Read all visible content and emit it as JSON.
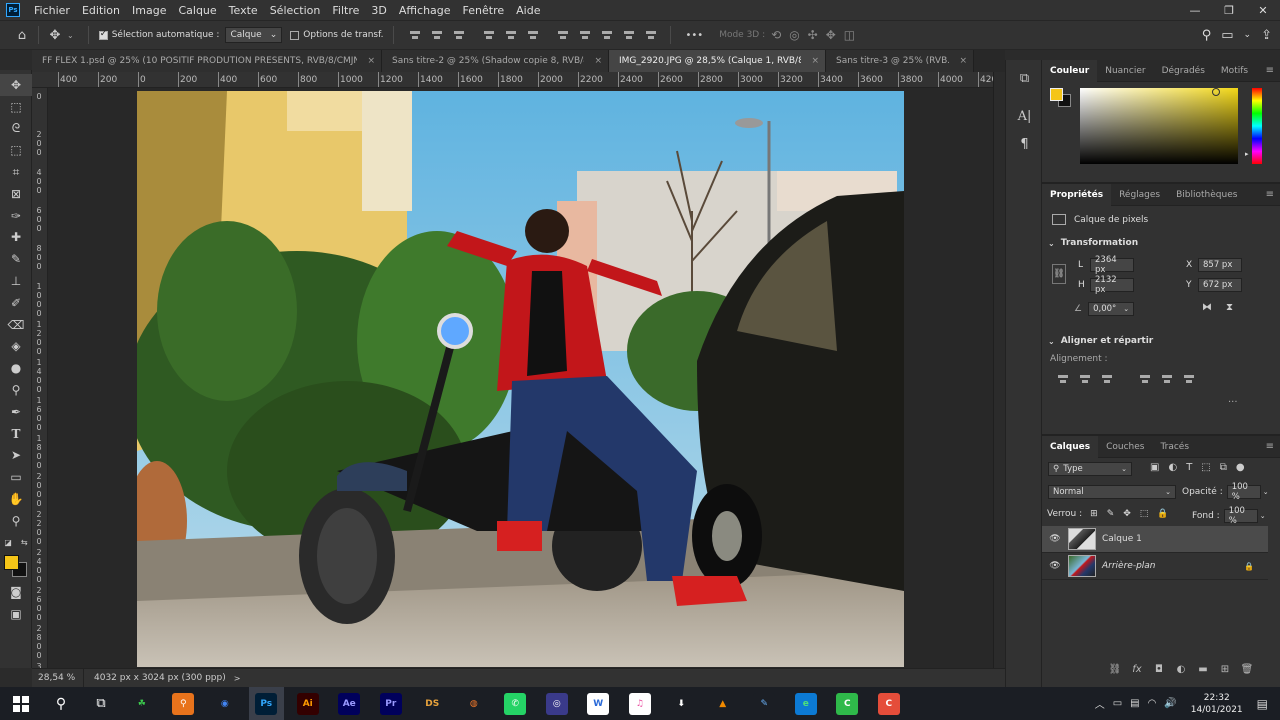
{
  "app": {
    "logo": "Ps"
  },
  "menubar": {
    "items": [
      "Fichier",
      "Edition",
      "Image",
      "Calque",
      "Texte",
      "Sélection",
      "Filtre",
      "3D",
      "Affichage",
      "Fenêtre",
      "Aide"
    ],
    "window_controls": [
      "—",
      "❐",
      "✕"
    ]
  },
  "optionsbar": {
    "auto_select_label": "Sélection automatique :",
    "auto_select_value": "Calque",
    "transform_options_label": "Options de transf.",
    "mode_3d_label": "Mode 3D :",
    "more_label": "•••"
  },
  "tabs": [
    {
      "label": "FF FLEX 1.psd @ 25% (10 POSITIF PRODUTION  PRESENTS, RVB/8/CMJN...",
      "active": false
    },
    {
      "label": "Sans titre-2 @ 25% (Shadow copie 8, RVB/8/...",
      "active": false
    },
    {
      "label": "IMG_2920.JPG @ 28,5% (Calque 1, RVB/8) *",
      "active": true
    },
    {
      "label": "Sans titre-3 @ 25% (RVB...",
      "active": false
    }
  ],
  "ruler": {
    "h_labels": [
      "400",
      "200",
      "0",
      "200",
      "400",
      "600",
      "800",
      "1000",
      "1200",
      "1400",
      "1600",
      "1800",
      "2000",
      "2200",
      "2400",
      "2600",
      "2800",
      "3000",
      "3200",
      "3400",
      "3600",
      "3800",
      "4000",
      "4200",
      "4400"
    ],
    "v_labels": [
      "0",
      "200",
      "400",
      "600",
      "800",
      "1000",
      "1200",
      "1400",
      "1600",
      "1800",
      "2000",
      "2200",
      "2400",
      "2600",
      "2800",
      "3000"
    ]
  },
  "statusbar": {
    "zoom": "28,54 %",
    "doc_info": "4032 px x 3024 px (300 ppp)",
    "arrow": ">"
  },
  "color_panel": {
    "tabs": [
      "Couleur",
      "Nuancier",
      "Dégradés",
      "Motifs"
    ],
    "fg_color": "#f5c518",
    "bg_color": "#111111"
  },
  "properties_panel": {
    "tabs": [
      "Propriétés",
      "Réglages",
      "Bibliothèques"
    ],
    "layer_type": "Calque de pixels",
    "transform_title": "Transformation",
    "w_label": "L",
    "w_value": "2364 px",
    "h_label": "H",
    "h_value": "2132 px",
    "x_label": "X",
    "x_value": "857 px",
    "y_label": "Y",
    "y_value": "672 px",
    "angle_value": "0,00°",
    "align_title": "Aligner et répartir",
    "align_sub": "Alignement :",
    "more": "..."
  },
  "layers_panel": {
    "tabs": [
      "Calques",
      "Couches",
      "Tracés"
    ],
    "filter_label": "Type",
    "blend_mode": "Normal",
    "opacity_label": "Opacité :",
    "opacity_value": "100 %",
    "lock_label": "Verrou :",
    "fill_label": "Fond :",
    "fill_value": "100 %",
    "layers": [
      {
        "name": "Calque 1",
        "selected": true,
        "italic": false
      },
      {
        "name": "Arrière-plan",
        "selected": false,
        "italic": true
      }
    ]
  },
  "taskbar": {
    "time": "22:32",
    "date": "14/01/2021",
    "apps": [
      {
        "icon": "clover-icon",
        "label": "☘",
        "bg": "#1b1e24",
        "fg": "#3ccf4e"
      },
      {
        "icon": "search-app-icon",
        "label": "⚲",
        "bg": "#e8731c",
        "fg": "#fff"
      },
      {
        "icon": "chrome-icon",
        "label": "◉",
        "bg": "#1b1e24",
        "fg": "#4285f4"
      },
      {
        "icon": "photoshop-icon",
        "label": "Ps",
        "bg": "#001e36",
        "fg": "#31a8ff"
      },
      {
        "icon": "illustrator-icon",
        "label": "Ai",
        "bg": "#330000",
        "fg": "#ff9a00"
      },
      {
        "icon": "after-effects-icon",
        "label": "Ae",
        "bg": "#00005b",
        "fg": "#9999ff"
      },
      {
        "icon": "premiere-icon",
        "label": "Pr",
        "bg": "#00005b",
        "fg": "#9999ff"
      },
      {
        "icon": "ds-icon",
        "label": "DS",
        "bg": "#1b1e24",
        "fg": "#e8a33c"
      },
      {
        "icon": "blender-icon",
        "label": "◍",
        "bg": "#1b1e24",
        "fg": "#f5792a"
      },
      {
        "icon": "whatsapp-icon",
        "label": "✆",
        "bg": "#25d366",
        "fg": "#fff"
      },
      {
        "icon": "davinci-icon",
        "label": "◎",
        "bg": "#3a3a8a",
        "fg": "#fff"
      },
      {
        "icon": "wps-icon",
        "label": "W",
        "bg": "#fff",
        "fg": "#2a6ad8"
      },
      {
        "icon": "itunes-icon",
        "label": "♫",
        "bg": "#fff",
        "fg": "#e94ea0"
      },
      {
        "icon": "download-icon",
        "label": "⬇",
        "bg": "#1b1e24",
        "fg": "#fff"
      },
      {
        "icon": "vlc-icon",
        "label": "▲",
        "bg": "#1b1e24",
        "fg": "#f18a00"
      },
      {
        "icon": "paint-icon",
        "label": "✎",
        "bg": "#1b1e24",
        "fg": "#6ab0f5"
      },
      {
        "icon": "edge-icon",
        "label": "e",
        "bg": "#0c7ad4",
        "fg": "#4ee07a"
      },
      {
        "icon": "camtasia-icon",
        "label": "C",
        "bg": "#2fb94a",
        "fg": "#fff"
      },
      {
        "icon": "capcut-icon",
        "label": "C",
        "bg": "#e54d3a",
        "fg": "#fff"
      }
    ]
  }
}
